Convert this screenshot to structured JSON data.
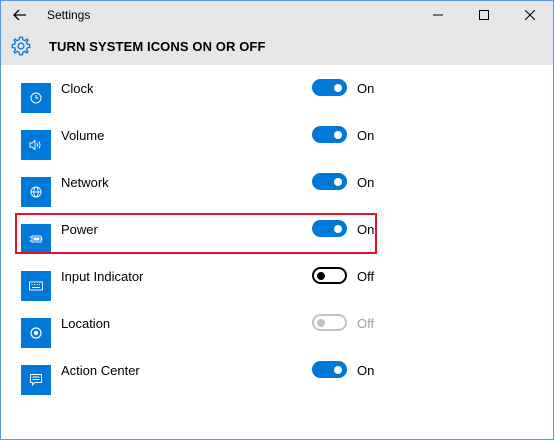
{
  "window": {
    "title": "Settings",
    "back_icon": "back-arrow-icon",
    "controls": [
      "minimize-icon",
      "maximize-icon",
      "close-icon"
    ]
  },
  "header": {
    "icon": "gear-icon",
    "title": "TURN SYSTEM ICONS ON OR OFF"
  },
  "accent_color": "#0078d7",
  "highlight_color": "#e81123",
  "items": [
    {
      "label": "Clock",
      "icon": "clock-icon",
      "state": "On",
      "enabled": true
    },
    {
      "label": "Volume",
      "icon": "volume-icon",
      "state": "On",
      "enabled": true
    },
    {
      "label": "Network",
      "icon": "network-globe-icon",
      "state": "On",
      "enabled": true
    },
    {
      "label": "Power",
      "icon": "battery-power-icon",
      "state": "On",
      "enabled": true,
      "highlighted": true
    },
    {
      "label": "Input Indicator",
      "icon": "keyboard-icon",
      "state": "Off",
      "enabled": true
    },
    {
      "label": "Location",
      "icon": "location-icon",
      "state": "Off",
      "enabled": false
    },
    {
      "label": "Action Center",
      "icon": "action-center-icon",
      "state": "On",
      "enabled": true
    }
  ]
}
